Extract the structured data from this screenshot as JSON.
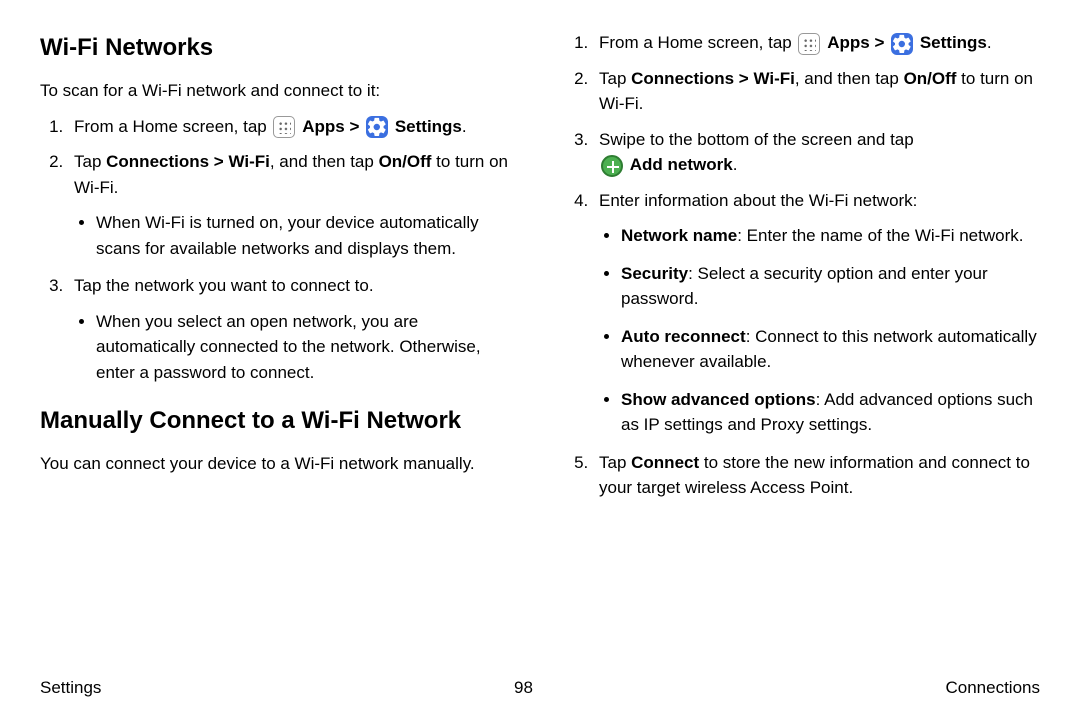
{
  "left": {
    "h1": "Wi-Fi Networks",
    "intro": "To scan for a Wi-Fi network and connect to it:",
    "step1_a": "From a Home screen, tap ",
    "step1_apps": "Apps",
    "step1_gt": " > ",
    "step1_settings": "Settings",
    "step1_dot": ".",
    "step2_a": "Tap ",
    "step2_path": "Connections > Wi-Fi",
    "step2_b": ", and then tap ",
    "step2_onoff": "On/Off",
    "step2_c": " to turn on Wi-Fi.",
    "step2_sub": "When Wi-Fi is turned on, your device automatically scans for available networks and displays them.",
    "step3": "Tap the network you want to connect to.",
    "step3_sub": "When you select an open network, you are automatically connected to the network. Otherwise, enter a password to connect.",
    "h2": "Manually Connect to a Wi-Fi Network",
    "intro2": "You can connect your device to a Wi-Fi network manually."
  },
  "right": {
    "step1_a": "From a Home screen, tap ",
    "step1_apps": "Apps",
    "step1_gt": " > ",
    "step1_settings": "Settings",
    "step1_dot": ".",
    "step2_a": "Tap ",
    "step2_path": "Connections > Wi-Fi",
    "step2_b": ", and then tap ",
    "step2_onoff": "On/Off",
    "step2_c": " to turn on Wi-Fi.",
    "step3_a": "Swipe to the bottom of the screen and tap ",
    "step3_add": "Add network",
    "step3_dot": ".",
    "step4": "Enter information about the Wi-Fi network:",
    "s4a_b": "Network name",
    "s4a_t": ": Enter the name of the Wi-Fi network.",
    "s4b_b": "Security",
    "s4b_t": ": Select a security option and enter your password.",
    "s4c_b": "Auto reconnect",
    "s4c_t": ": Connect to this network automatically whenever available.",
    "s4d_b": "Show advanced options",
    "s4d_t": ": Add advanced options such as IP settings and Proxy settings.",
    "step5_a": "Tap ",
    "step5_b": "Connect",
    "step5_c": " to store the new information and connect to your target wireless Access Point."
  },
  "footer": {
    "left": "Settings",
    "center": "98",
    "right": "Connections"
  }
}
